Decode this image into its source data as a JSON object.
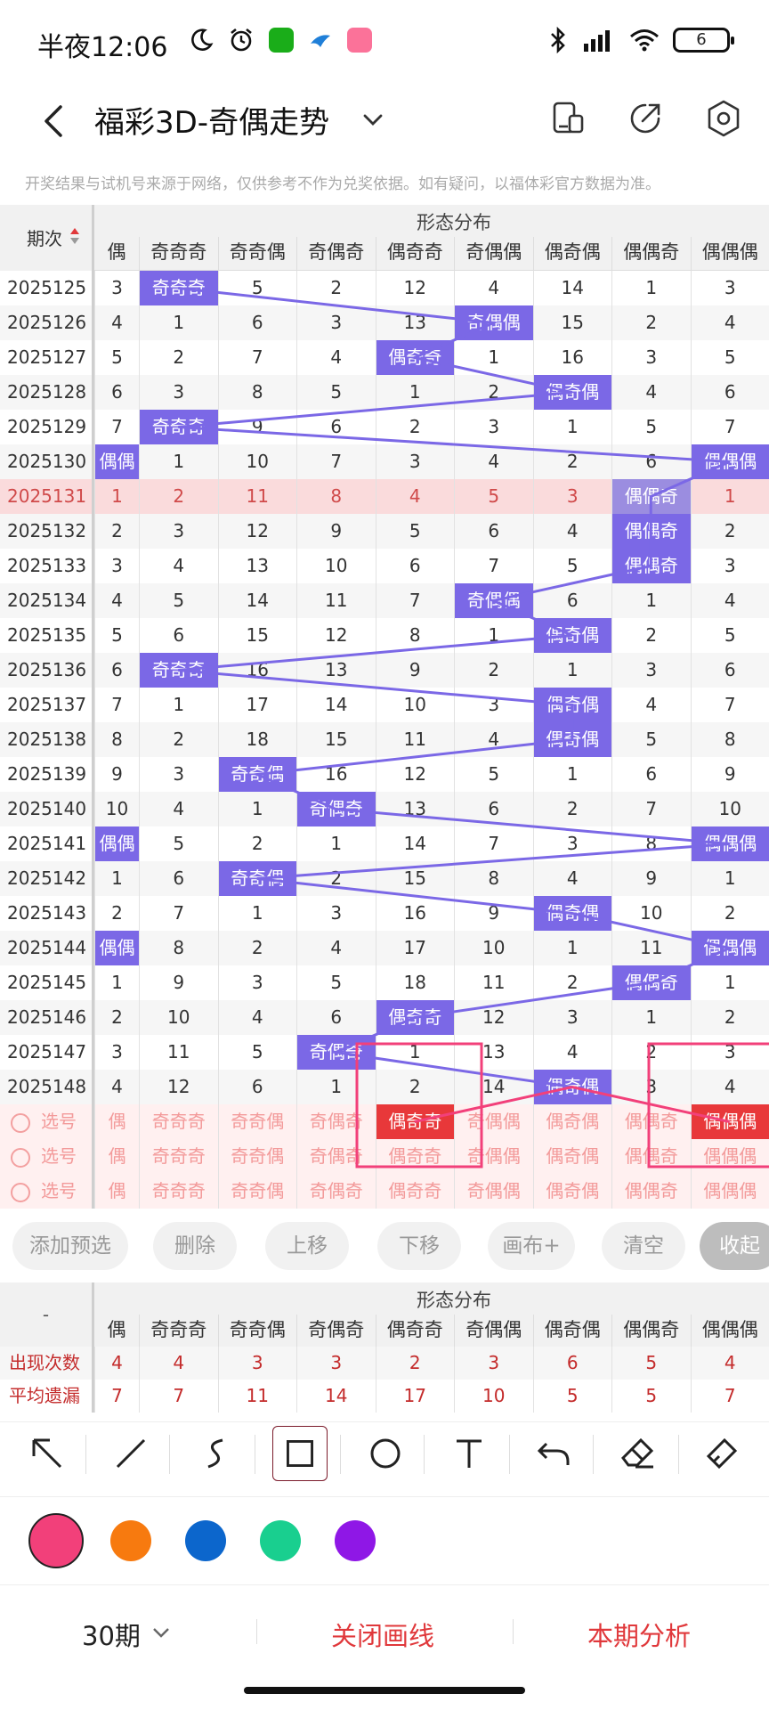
{
  "status": {
    "time": "半夜12:06",
    "battery": "6"
  },
  "header": {
    "title": "福彩3D-奇偶走势",
    "disclaimer": "开奖结果与试机号来源于网络，仅供参考不作为兑奖依据。如有疑问，以福体彩官方数据为准。"
  },
  "table": {
    "period_header": "期次",
    "group_label": "形态分布",
    "partial_label": "偶",
    "columns": [
      "奇奇奇",
      "奇奇偶",
      "奇偶奇",
      "偶奇奇",
      "奇偶偶",
      "偶奇偶",
      "偶偶奇",
      "偶偶偶"
    ],
    "rows": [
      {
        "period": "2025125",
        "partial": "3",
        "cells": [
          "奇奇奇",
          "5",
          "2",
          "12",
          "4",
          "14",
          "1",
          "3"
        ]
      },
      {
        "period": "2025126",
        "partial": "4",
        "cells": [
          "1",
          "6",
          "3",
          "13",
          "奇偶偶",
          "15",
          "2",
          "4"
        ]
      },
      {
        "period": "2025127",
        "partial": "5",
        "cells": [
          "2",
          "7",
          "4",
          "偶奇奇",
          "1",
          "16",
          "3",
          "5"
        ]
      },
      {
        "period": "2025128",
        "partial": "6",
        "cells": [
          "3",
          "8",
          "5",
          "1",
          "2",
          "偶奇偶",
          "4",
          "6"
        ]
      },
      {
        "period": "2025129",
        "partial": "7",
        "cells": [
          "奇奇奇",
          "9",
          "6",
          "2",
          "3",
          "1",
          "5",
          "7"
        ]
      },
      {
        "period": "2025130",
        "partial": "偶偶",
        "cells": [
          "1",
          "10",
          "7",
          "3",
          "4",
          "2",
          "6",
          "偶偶偶"
        ]
      },
      {
        "period": "2025131",
        "partial": "1",
        "cells": [
          "2",
          "11",
          "8",
          "4",
          "5",
          "3",
          "偶偶奇",
          "1"
        ]
      },
      {
        "period": "2025132",
        "partial": "2",
        "cells": [
          "3",
          "12",
          "9",
          "5",
          "6",
          "4",
          "偶偶奇",
          "2"
        ]
      },
      {
        "period": "2025133",
        "partial": "3",
        "cells": [
          "4",
          "13",
          "10",
          "6",
          "7",
          "5",
          "偶偶奇",
          "3"
        ]
      },
      {
        "period": "2025134",
        "partial": "4",
        "cells": [
          "5",
          "14",
          "11",
          "7",
          "奇偶偶",
          "6",
          "1",
          "4"
        ]
      },
      {
        "period": "2025135",
        "partial": "5",
        "cells": [
          "6",
          "15",
          "12",
          "8",
          "1",
          "偶奇偶",
          "2",
          "5"
        ]
      },
      {
        "period": "2025136",
        "partial": "6",
        "cells": [
          "奇奇奇",
          "16",
          "13",
          "9",
          "2",
          "1",
          "3",
          "6"
        ]
      },
      {
        "period": "2025137",
        "partial": "7",
        "cells": [
          "1",
          "17",
          "14",
          "10",
          "3",
          "偶奇偶",
          "4",
          "7"
        ]
      },
      {
        "period": "2025138",
        "partial": "8",
        "cells": [
          "2",
          "18",
          "15",
          "11",
          "4",
          "偶奇偶",
          "5",
          "8"
        ]
      },
      {
        "period": "2025139",
        "partial": "9",
        "cells": [
          "3",
          "奇奇偶",
          "16",
          "12",
          "5",
          "1",
          "6",
          "9"
        ]
      },
      {
        "period": "2025140",
        "partial": "10",
        "cells": [
          "4",
          "1",
          "奇偶奇",
          "13",
          "6",
          "2",
          "7",
          "10"
        ]
      },
      {
        "period": "2025141",
        "partial": "偶偶",
        "cells": [
          "5",
          "2",
          "1",
          "14",
          "7",
          "3",
          "8",
          "偶偶偶"
        ]
      },
      {
        "period": "2025142",
        "partial": "1",
        "cells": [
          "6",
          "奇奇偶",
          "2",
          "15",
          "8",
          "4",
          "9",
          "1"
        ]
      },
      {
        "period": "2025143",
        "partial": "2",
        "cells": [
          "7",
          "1",
          "3",
          "16",
          "9",
          "偶奇偶",
          "10",
          "2"
        ]
      },
      {
        "period": "2025144",
        "partial": "偶偶",
        "cells": [
          "8",
          "2",
          "4",
          "17",
          "10",
          "1",
          "11",
          "偶偶偶"
        ]
      },
      {
        "period": "2025145",
        "partial": "1",
        "cells": [
          "9",
          "3",
          "5",
          "18",
          "11",
          "2",
          "偶偶奇",
          "1"
        ]
      },
      {
        "period": "2025146",
        "partial": "2",
        "cells": [
          "10",
          "4",
          "6",
          "偶奇奇",
          "12",
          "3",
          "1",
          "2"
        ]
      },
      {
        "period": "2025147",
        "partial": "3",
        "cells": [
          "11",
          "5",
          "奇偶奇",
          "1",
          "13",
          "4",
          "2",
          "3"
        ]
      },
      {
        "period": "2025148",
        "partial": "4",
        "cells": [
          "12",
          "6",
          "1",
          "2",
          "14",
          "偶奇偶",
          "3",
          "4"
        ]
      }
    ],
    "highlight_period": "2025131",
    "select_label": "选号",
    "select_rows": 3
  },
  "actions": {
    "add_preselect": "添加预选",
    "delete": "删除",
    "move_up": "上移",
    "move_down": "下移",
    "canvas_plus": "画布+",
    "clear": "清空",
    "collapse": "收起"
  },
  "stats": {
    "dash": "-",
    "group_label": "形态分布",
    "appear_label": "出现次数",
    "avg_label": "平均遗漏",
    "appear_partial": "4",
    "avg_partial": "7",
    "appear": [
      "4",
      "3",
      "3",
      "2",
      "3",
      "6",
      "5",
      "4"
    ],
    "avg_omit": [
      "7",
      "11",
      "14",
      "17",
      "10",
      "5",
      "5",
      "7"
    ]
  },
  "palette": {
    "pink": "#f2407a",
    "orange": "#f77a0f",
    "blue": "#0c66cc",
    "green": "#19cf8f",
    "purple": "#8f17e6",
    "hit": "#7b68e6",
    "accent": "#e0383b"
  },
  "tools": [
    "arrow-tool",
    "line-tool",
    "curve-tool",
    "rectangle-tool",
    "circle-tool",
    "text-tool",
    "undo-tool",
    "eraser-tool",
    "brush-tool"
  ],
  "bottom": {
    "periods": "30期",
    "close_lines": "关闭画线",
    "analysis": "本期分析"
  }
}
